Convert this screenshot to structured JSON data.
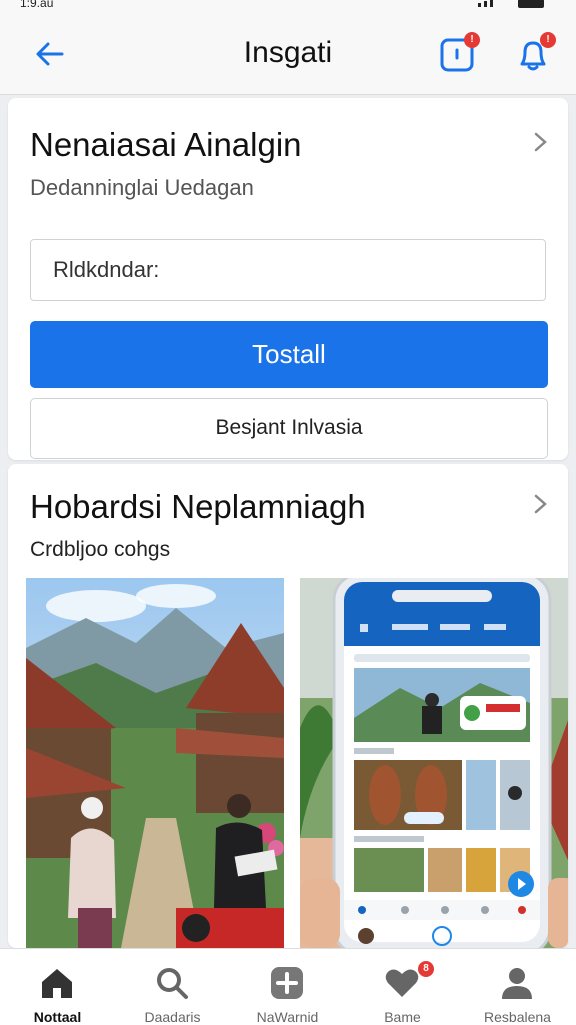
{
  "status_bar": {
    "time": "1:9.au"
  },
  "header": {
    "title": "Insgati",
    "notification_badge": "!",
    "bell_badge": "!"
  },
  "card1": {
    "title": "Nenaiasai Ainalgin",
    "subtitle": "Dedanninglai Uedagan",
    "input_value": "Rldkdndar:",
    "primary_button": "Tostall",
    "secondary_button": "Besjant Inlvasia"
  },
  "card2": {
    "title": "Hobardsi Neplamniagh",
    "subtitle": "Crdbljoo cohgs"
  },
  "bottom_nav": {
    "items": [
      {
        "label": "Nottaal",
        "icon": "home-icon",
        "active": true
      },
      {
        "label": "Daadaris",
        "icon": "search-icon"
      },
      {
        "label": "NaWarnid",
        "icon": "add-icon"
      },
      {
        "label": "Bame",
        "icon": "heart-icon",
        "badge": "8"
      },
      {
        "label": "Resbalena",
        "icon": "profile-icon"
      }
    ]
  },
  "colors": {
    "accent": "#1a73e8",
    "badge": "#e53935",
    "background": "#eceef1"
  }
}
